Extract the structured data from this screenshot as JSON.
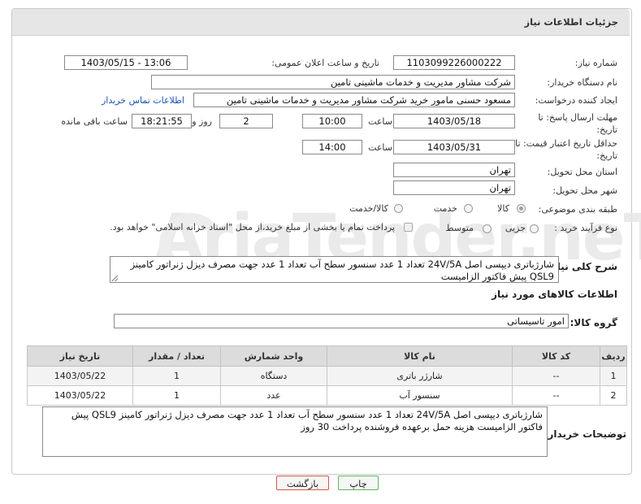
{
  "panel_title": "جزئیات اطلاعات نیاز",
  "need_number_label": "شماره نیاز:",
  "need_number": "1103099226000222",
  "announce_label": "تاریخ و ساعت اعلان عمومی:",
  "announce_value": "1403/05/15 - 13:06",
  "buyer_org_label": "نام دستگاه خریدار:",
  "buyer_org": "شرکت مشاور مدیریت و خدمات ماشینی تامین",
  "creator_label": "ایجاد کننده درخواست:",
  "creator": "مسعود حسنی مامور خرید شرکت مشاور مدیریت و خدمات ماشینی تامین",
  "contact_link": "اطلاعات تماس خریدار",
  "reply_deadline_label": "مهلت ارسال پاسخ: تا تاریخ:",
  "reply_date": "1403/05/18",
  "time_label": "ساعت",
  "reply_time": "10:00",
  "days_value": "2",
  "days_label": "روز و",
  "remaining_time": "18:21:55",
  "remaining_label": "ساعت باقی مانده",
  "price_validity_label": "حداقل تاریخ اعتبار قیمت: تا تاریخ:",
  "price_date": "1403/05/31",
  "price_time": "14:00",
  "province_label": "استان محل تحویل:",
  "province": "تهران",
  "city_label": "شهر محل تحویل:",
  "city": "تهران",
  "category_label": "طبقه بندی موضوعی:",
  "category_options": [
    "کالا",
    "خدمت",
    "کالا/خدمت"
  ],
  "process_label": "نوع فرآیند خرید :",
  "process_options": [
    "جزیی",
    "متوسط"
  ],
  "payment_note": "پرداخت تمام یا بخشی از مبلغ خرید،از محل \"اسناد خزانه اسلامی\" خواهد بود.",
  "summary_label": "شرح کلی نیاز:",
  "summary_text": "شارژباتری دیپسی اصل 24V/5A تعداد 1 عدد  سنسور سطح آب  تعداد 1 عدد   جهت مصرف دیزل ژنراتور کامینز QSL9  پیش فاکتور الزامیست",
  "goods_info_title": "اطلاعات کالاهای مورد نیاز",
  "goods_group_label": "گروه کالا:",
  "goods_group": "امور تاسیساتی",
  "table": {
    "headers": [
      "ردیف",
      "کد کالا",
      "نام کالا",
      "واحد شمارش",
      "تعداد / مقدار",
      "تاریخ نیاز"
    ],
    "rows": [
      [
        "1",
        "--",
        "شارژر باتری",
        "دستگاه",
        "1",
        "1403/05/22"
      ],
      [
        "2",
        "--",
        "سنسور آب",
        "عدد",
        "1",
        "1403/05/22"
      ]
    ]
  },
  "buyer_notes_label": "توضیحات خریدار:",
  "buyer_notes": "شارژباتری دیپسی اصل 24V/5A تعداد 1 عدد  سنسور سطح آب  تعداد 1 عدد   جهت مصرف دیزل ژنراتور کامینز QSL9  پیش فاکتور الزامیست هزینه حمل برعهده فروشنده پرداخت 30 روز",
  "print_button": "چاپ",
  "back_button": "بازگشت",
  "watermark": "AriaTender.neT",
  "colors": {
    "back_border": "#d9534f",
    "print_border": "#5cb85c",
    "link": "#1a55b5"
  }
}
